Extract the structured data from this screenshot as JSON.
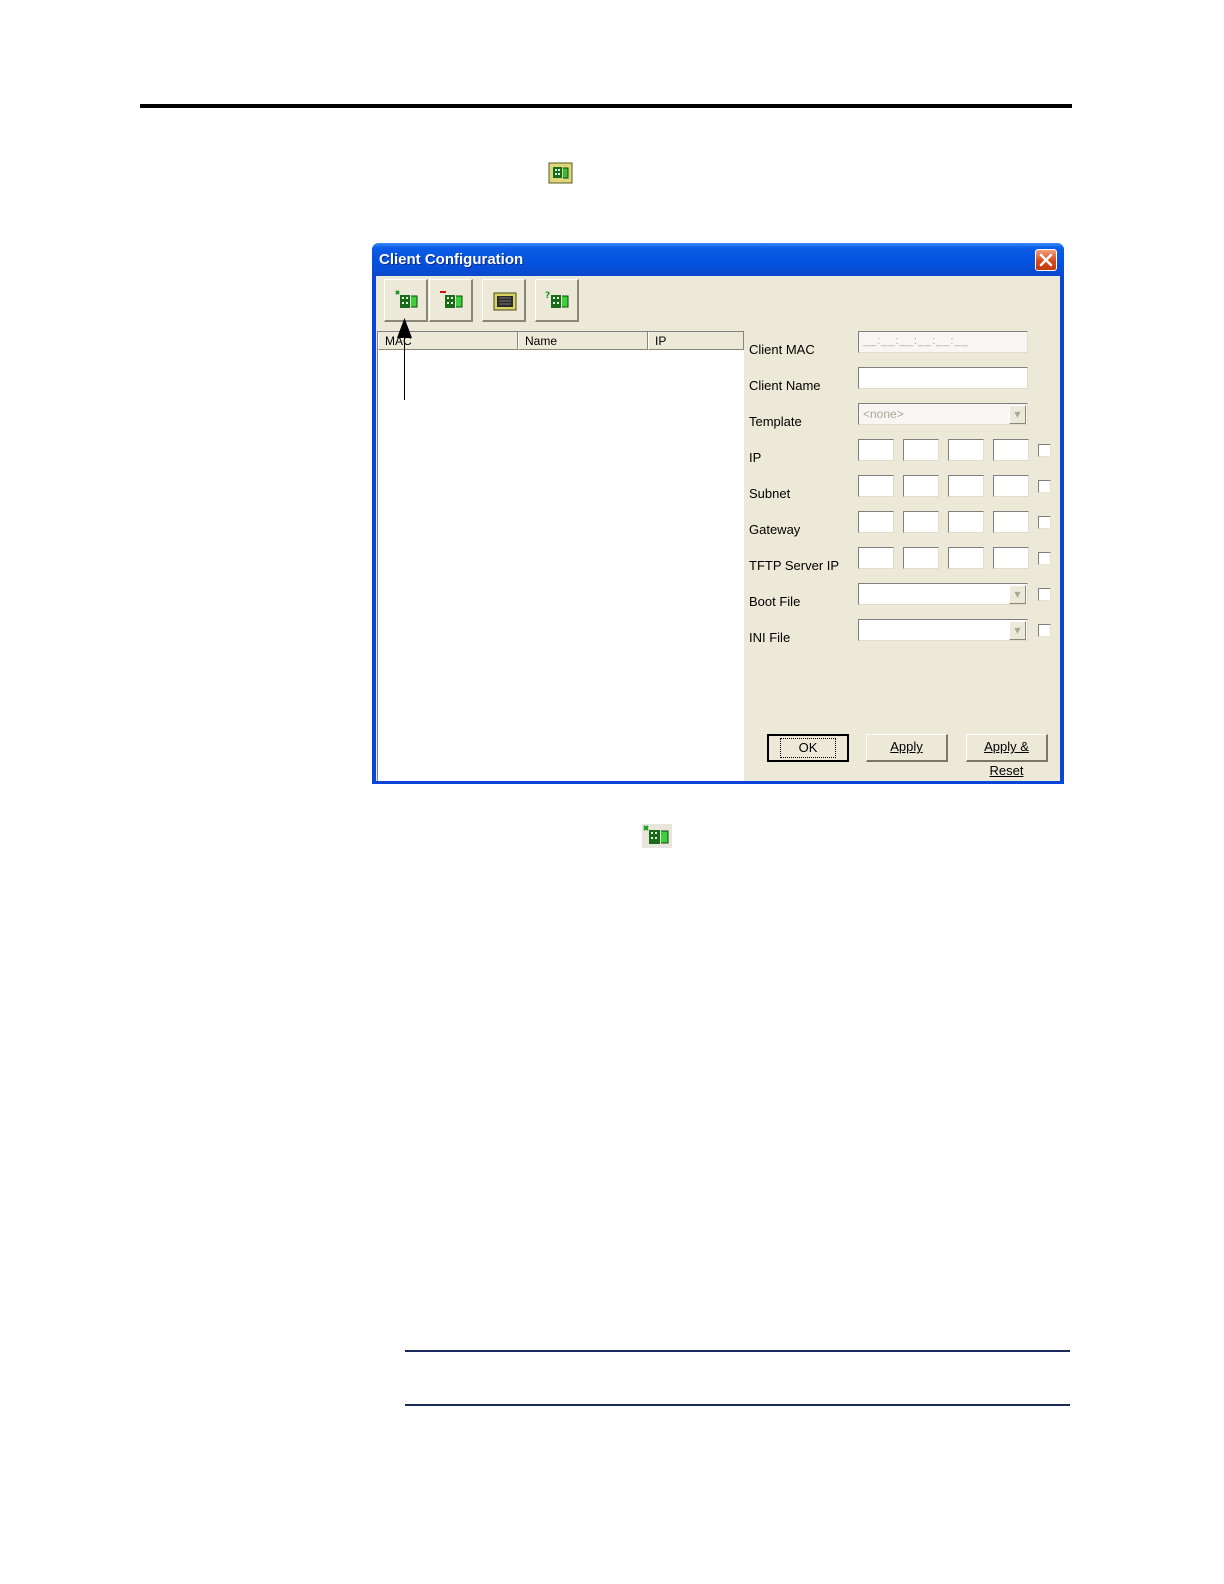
{
  "dialog": {
    "title": "Client Configuration",
    "toolbar": [
      {
        "name": "add-client-button",
        "icon": "add-client-icon"
      },
      {
        "name": "delete-client-button",
        "icon": "delete-client-icon"
      },
      {
        "name": "open-folder-button",
        "icon": "folder-icon"
      },
      {
        "name": "help-client-button",
        "icon": "help-client-icon"
      }
    ],
    "list": {
      "columns": [
        "MAC",
        "Name",
        "IP"
      ],
      "rows": []
    },
    "form": {
      "client_mac_label": "Client MAC",
      "client_mac_mask": "__:__:__:__:__:__",
      "client_name_label": "Client Name",
      "template_label": "Template",
      "template_value": "<none>",
      "ip_label": "IP",
      "subnet_label": "Subnet",
      "gateway_label": "Gateway",
      "tftp_label": "TFTP Server IP",
      "boot_file_label": "Boot File",
      "ini_file_label": "INI File"
    },
    "buttons": {
      "ok": "OK",
      "apply": "Apply",
      "apply_reset": "Apply & Reset"
    }
  }
}
